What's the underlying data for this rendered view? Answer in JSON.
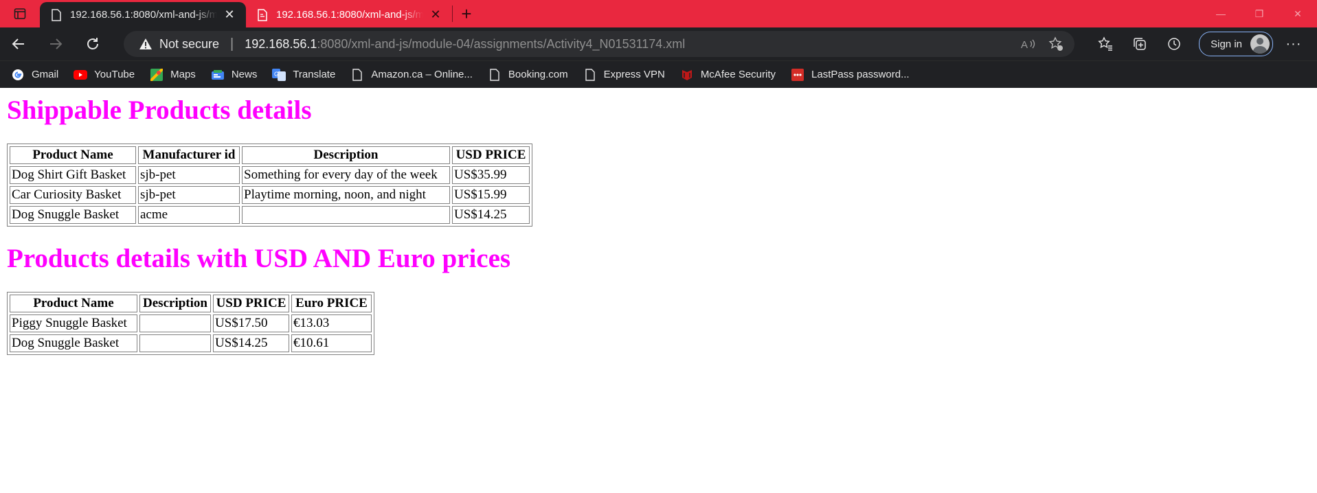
{
  "tabs": [
    {
      "title": "192.168.56.1:8080/xml-and-js/module-04/assignments/Activity4_N01531174.xml",
      "active": true
    },
    {
      "title": "192.168.56.1:8080/xml-and-js/module-04/assignments/Activity4_N01531174.xml",
      "active": false
    }
  ],
  "address_bar": {
    "security_label": "Not secure",
    "url_host": "192.168.56.1",
    "url_rest": ":8080/xml-and-js/module-04/assignments/Activity4_N01531174.xml"
  },
  "toolbar": {
    "signin_label": "Sign in"
  },
  "bookmarks": [
    {
      "label": "Gmail",
      "icon": "google-icon"
    },
    {
      "label": "YouTube",
      "icon": "youtube-icon"
    },
    {
      "label": "Maps",
      "icon": "maps-icon"
    },
    {
      "label": "News",
      "icon": "news-icon"
    },
    {
      "label": "Translate",
      "icon": "translate-icon"
    },
    {
      "label": "Amazon.ca – Online...",
      "icon": "page-icon"
    },
    {
      "label": "Booking.com",
      "icon": "page-icon"
    },
    {
      "label": "Express VPN",
      "icon": "page-icon"
    },
    {
      "label": "McAfee Security",
      "icon": "mcafee-icon"
    },
    {
      "label": "LastPass password...",
      "icon": "lastpass-icon"
    }
  ],
  "colors": {
    "tab_bar": "#e9283f",
    "chrome_dark": "#202124",
    "heading": "#ff00ff",
    "signin_border": "#8ab4f8"
  },
  "page": {
    "section1": {
      "heading": "Shippable Products details",
      "headers": [
        "Product Name",
        "Manufacturer id",
        "Description",
        "USD PRICE"
      ],
      "rows": [
        [
          "Dog Shirt Gift Basket",
          "sjb-pet",
          "Something for every day of the week",
          "US$35.99"
        ],
        [
          "Car Curiosity Basket",
          "sjb-pet",
          "Playtime morning, noon, and night",
          "US$15.99"
        ],
        [
          "Dog Snuggle Basket",
          "acme",
          "",
          "US$14.25"
        ]
      ]
    },
    "section2": {
      "heading": "Products details with USD AND Euro prices",
      "headers": [
        "Product Name",
        "Description",
        "USD PRICE",
        "Euro PRICE"
      ],
      "rows": [
        [
          "Piggy Snuggle Basket",
          "",
          "US$17.50",
          "€13.03"
        ],
        [
          "Dog Snuggle Basket",
          "",
          "US$14.25",
          "€10.61"
        ]
      ]
    }
  }
}
